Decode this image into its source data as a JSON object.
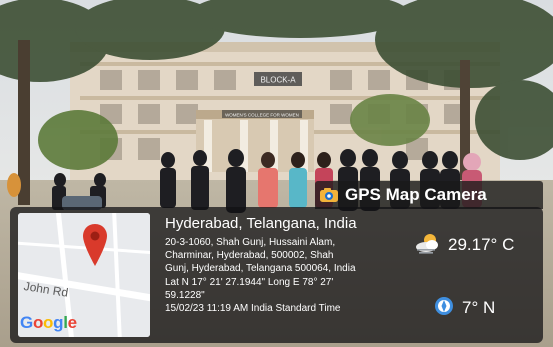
{
  "photo": {
    "sign_block": "BLOCK-A",
    "sign_college": "WOMEN'S COLLEGE FOR WOMEN"
  },
  "watermark": {
    "app_name": "GPS Map Camera",
    "icon": "camera-icon"
  },
  "map": {
    "road_label": "John Rd",
    "provider": "Google",
    "icons": [
      "map-pin-icon"
    ]
  },
  "location": {
    "title": "Hyderabad, Telangana, India",
    "address_lines": [
      "20-3-1060, Shah Gunj, Hussaini Alam,",
      "Charminar, Hyderabad, 500002, Shah",
      "Gunj, Hyderabad, Telangana 500064, India",
      "Lat N 17° 21' 27.1944\" Long E 78° 27'",
      "59.1228\"",
      "15/02/23 11:19 AM India Standard Time"
    ]
  },
  "weather": {
    "temperature": "29.17° C",
    "icon": "cloud-sun-icon"
  },
  "wind": {
    "value": "7° N",
    "icon": "wind-compass-icon"
  },
  "colors": {
    "overlay": "#121214",
    "pin": "#d93a2b",
    "google_blue": "#4285f4",
    "google_red": "#ea4335",
    "google_yellow": "#fbbc05",
    "google_green": "#34a853"
  }
}
